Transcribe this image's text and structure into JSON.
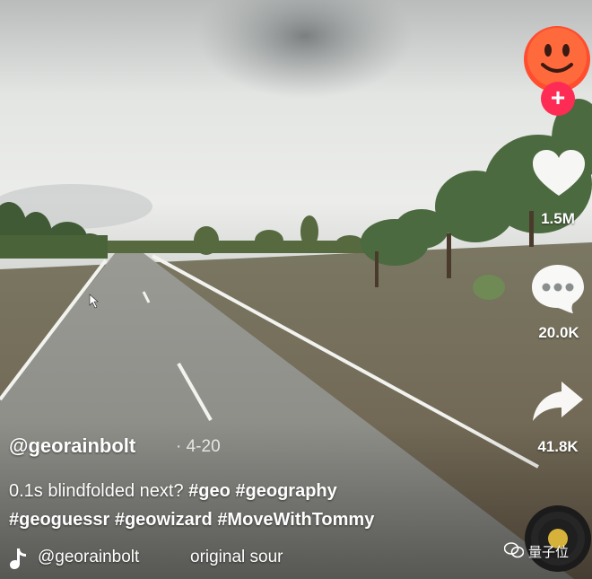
{
  "video": {
    "author_handle": "@georainbolt",
    "date": "· 4-20",
    "caption_text": "0.1s blindfolded next?",
    "hashtags": [
      "#geo",
      "#geography",
      "#geoguessr",
      "#geowizard",
      "#MoveWithTommy"
    ]
  },
  "actions": {
    "like_count": "1.5M",
    "comment_count": "20.0K",
    "share_count": "41.8K"
  },
  "music": {
    "author": "@georainbolt",
    "title": "original sour"
  },
  "watermark": {
    "label": "量子位"
  },
  "icons": {
    "avatar": "emoji-avatar-icon",
    "follow": "plus-icon",
    "like": "heart-icon",
    "comment": "comment-bubble-icon",
    "share": "share-arrow-icon",
    "music": "music-note-icon",
    "disc": "music-disc-icon",
    "watermark": "wechat-icon"
  },
  "colors": {
    "follow_button": "#fe2c55",
    "avatar": "#ff4d2e"
  }
}
